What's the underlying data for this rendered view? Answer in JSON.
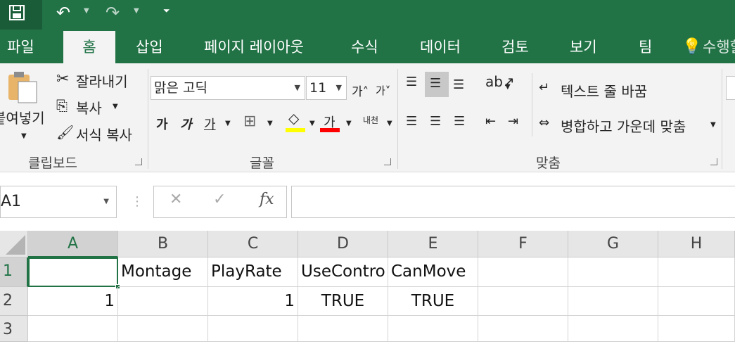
{
  "tabs": [
    "파일",
    "홈",
    "삽입",
    "페이지 레이아웃",
    "수식",
    "데이터",
    "검토",
    "보기",
    "팀"
  ],
  "tell_me": "수행할",
  "clipboard": {
    "paste": "붙여넣기",
    "cut": "잘라내기",
    "copy": "복사",
    "format_painter": "서식 복사",
    "group": "클립보드"
  },
  "font": {
    "name": "맑은 고딕",
    "size": "11",
    "bold": "가",
    "italic": "가",
    "underline": "가",
    "color_sample": "가",
    "phonetic": "내천",
    "group": "글꼴"
  },
  "align": {
    "wrap": "텍스트 줄 바꿈",
    "merge": "병합하고 가운데 맞춤",
    "group": "맞춤"
  },
  "name_box": "A1",
  "fx": "fx",
  "colors": {
    "brand": "#217346",
    "fill": "#ffff00",
    "font_color": "#ff0000"
  },
  "columns": [
    "A",
    "B",
    "C",
    "D",
    "E",
    "F",
    "G",
    "H"
  ],
  "rows": [
    "1",
    "2",
    "3"
  ],
  "cells": {
    "r1": [
      "",
      "Montage",
      "PlayRate",
      "UseContro",
      "CanMove",
      "",
      "",
      ""
    ],
    "r2": [
      "1",
      "",
      "1",
      "TRUE",
      "TRUE",
      "",
      "",
      ""
    ]
  }
}
